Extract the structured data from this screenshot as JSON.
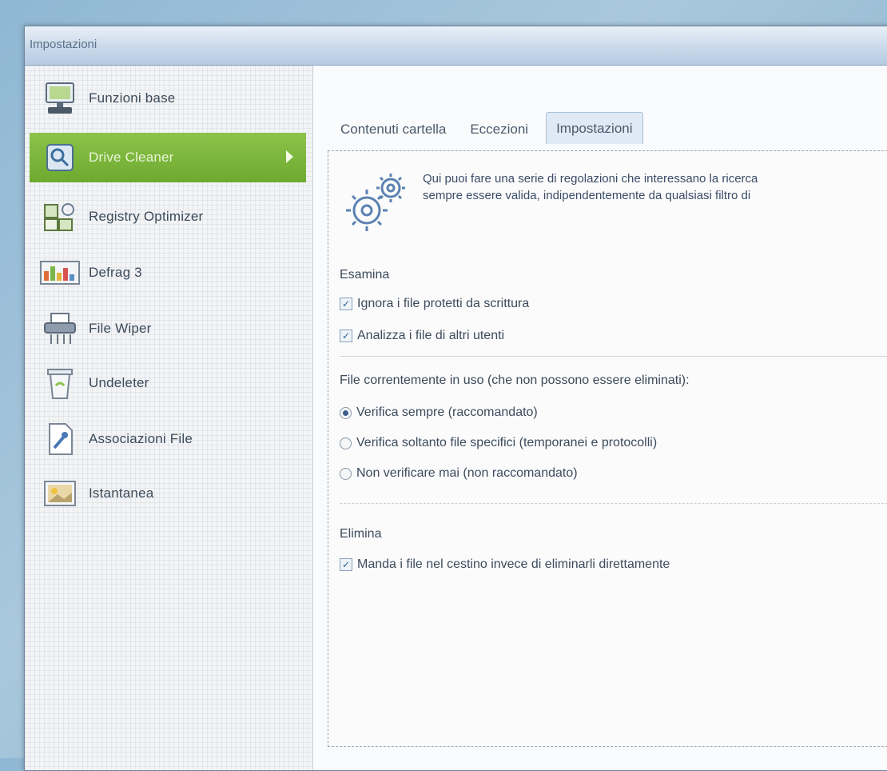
{
  "window": {
    "title": "Impostazioni"
  },
  "sidebar": {
    "items": [
      {
        "label": "Funzioni base",
        "icon": "computer-icon"
      },
      {
        "label": "Drive Cleaner",
        "icon": "drive-cleaner-icon",
        "active": true
      },
      {
        "label": "Registry Optimizer",
        "icon": "registry-icon"
      },
      {
        "label": "Defrag 3",
        "icon": "defrag-icon"
      },
      {
        "label": "File Wiper",
        "icon": "shredder-icon"
      },
      {
        "label": "Undeleter",
        "icon": "trash-icon"
      },
      {
        "label": "Associazioni File",
        "icon": "file-association-icon"
      },
      {
        "label": "Istantanea",
        "icon": "snapshot-icon"
      }
    ]
  },
  "tabs": [
    {
      "label": "Contenuti cartella"
    },
    {
      "label": "Eccezioni"
    },
    {
      "label": "Impostazioni",
      "active": true
    }
  ],
  "intro": {
    "line1": "Qui puoi fare una serie di regolazioni che interessano la ricerca",
    "line2": "sempre essere valida, indipendentemente da qualsiasi filtro di"
  },
  "scan": {
    "title": "Esamina",
    "options": [
      {
        "label": "Ignora i file protetti da scrittura",
        "checked": true
      },
      {
        "label": "Analizza i file di altri utenti",
        "checked": true
      }
    ]
  },
  "in_use": {
    "title": "File correntemente in uso (che non possono essere eliminati):",
    "options": [
      {
        "label": "Verifica sempre (raccomandato)",
        "selected": true
      },
      {
        "label": "Verifica soltanto file specifici (temporanei e protocolli)",
        "selected": false
      },
      {
        "label": "Non verificare mai (non raccomandato)",
        "selected": false
      }
    ]
  },
  "delete": {
    "title": "Elimina",
    "options": [
      {
        "label": "Manda i file nel cestino invece di eliminarli direttamente",
        "checked": true
      }
    ]
  },
  "colors": {
    "active_item": "#7bb43a",
    "accent_blue": "#3b4c66"
  }
}
